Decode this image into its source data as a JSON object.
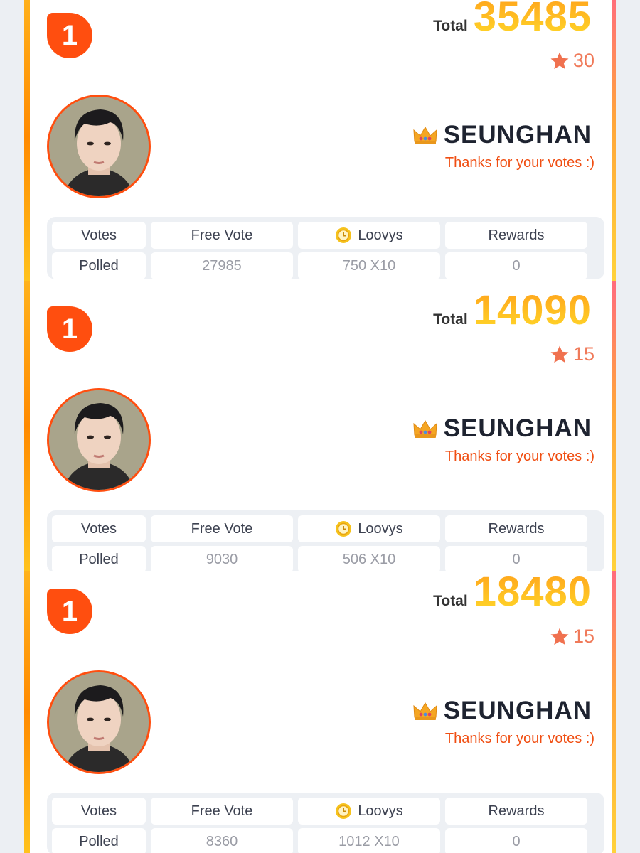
{
  "cards": [
    {
      "rank": "1",
      "total_label": "Total",
      "total_value": "35485",
      "stars": "30",
      "name": "SEUNGHAN",
      "thanks": "Thanks for your votes :)",
      "table": {
        "headers": [
          "Votes",
          "Free Vote",
          "Loovys",
          "Rewards"
        ],
        "row_label": "Polled",
        "values": [
          "27985",
          "750 X10",
          "0"
        ]
      }
    },
    {
      "rank": "1",
      "total_label": "Total",
      "total_value": "14090",
      "stars": "15",
      "name": "SEUNGHAN",
      "thanks": "Thanks for your votes :)",
      "table": {
        "headers": [
          "Votes",
          "Free Vote",
          "Loovys",
          "Rewards"
        ],
        "row_label": "Polled",
        "values": [
          "9030",
          "506 X10",
          "0"
        ]
      }
    },
    {
      "rank": "1",
      "total_label": "Total",
      "total_value": "18480",
      "stars": "15",
      "name": "SEUNGHAN",
      "thanks": "Thanks for your votes :)",
      "table": {
        "headers": [
          "Votes",
          "Free Vote",
          "Loovys",
          "Rewards"
        ],
        "row_label": "Polled",
        "values": [
          "8360",
          "1012 X10",
          "0"
        ]
      }
    }
  ],
  "colors": {
    "accent": "#ff4e0f",
    "total_gradient_top": "#ff9f1a",
    "total_gradient_bottom": "#ffdb2a",
    "star": "#f07a5a",
    "name": "#1e2330"
  },
  "icons": [
    "rank-badge",
    "star-icon",
    "crown-icon",
    "coin-icon",
    "avatar-photo"
  ]
}
